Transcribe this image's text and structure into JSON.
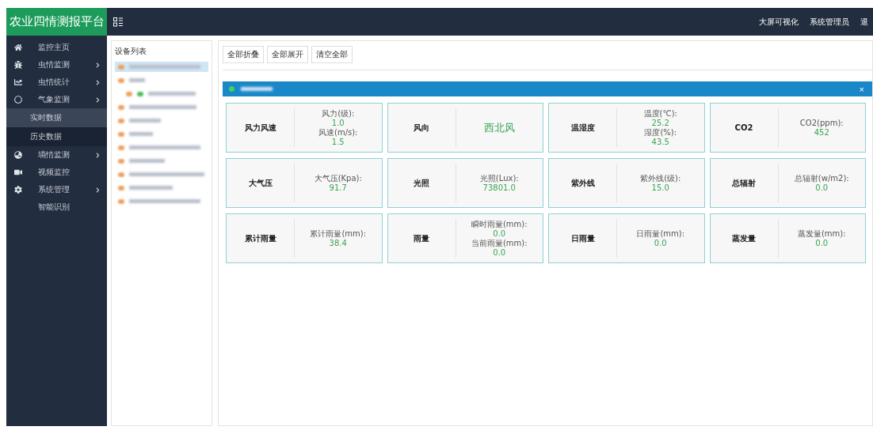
{
  "header": {
    "logo": "农业四情测报平台",
    "links": [
      "大屏可视化",
      "系统管理员",
      "退"
    ]
  },
  "sidebar": {
    "items": [
      {
        "label": "监控主页",
        "has_submenu": false
      },
      {
        "label": "虫情监测",
        "has_submenu": true
      },
      {
        "label": "虫情统计",
        "has_submenu": true
      },
      {
        "label": "气象监测",
        "has_submenu": true,
        "expanded": true,
        "children": [
          {
            "label": "实时数据",
            "selected": true
          },
          {
            "label": "历史数据",
            "selected": false
          }
        ]
      },
      {
        "label": "墒情监测",
        "has_submenu": true
      },
      {
        "label": "视频监控",
        "has_submenu": false
      },
      {
        "label": "系统管理",
        "has_submenu": true
      },
      {
        "label": "智能识别",
        "has_submenu": false
      }
    ]
  },
  "device_list": {
    "title": "设备列表",
    "rows": [
      {
        "selected": true
      },
      {
        "selected": false,
        "children": [
          {
            "selected": false
          }
        ]
      },
      {
        "selected": false
      },
      {
        "selected": false
      },
      {
        "selected": false
      },
      {
        "selected": false
      },
      {
        "selected": false
      },
      {
        "selected": false
      },
      {
        "selected": false
      },
      {
        "selected": false
      }
    ]
  },
  "toolbar": {
    "buttons": [
      "全部折叠",
      "全部展开",
      "清空全部"
    ]
  },
  "station": {
    "online": true,
    "close": "×"
  },
  "cards": [
    {
      "title": "风力风速",
      "kind": "readings",
      "readings": [
        {
          "label": "风力(级):",
          "value": "1.0"
        },
        {
          "label": "风速(m/s):",
          "value": "1.5"
        }
      ]
    },
    {
      "title": "风向",
      "kind": "text",
      "value": "西北风"
    },
    {
      "title": "温湿度",
      "kind": "readings",
      "readings": [
        {
          "label": "温度(℃):",
          "value": "25.2"
        },
        {
          "label": "湿度(%):",
          "value": "43.5"
        }
      ]
    },
    {
      "title": "CO2",
      "kind": "readings",
      "readings": [
        {
          "label": "CO2(ppm):",
          "value": "452"
        }
      ]
    },
    {
      "title": "大气压",
      "kind": "readings",
      "readings": [
        {
          "label": "大气压(Kpa):",
          "value": "91.7"
        }
      ]
    },
    {
      "title": "光照",
      "kind": "readings",
      "readings": [
        {
          "label": "光照(Lux):",
          "value": "73801.0"
        }
      ]
    },
    {
      "title": "紫外线",
      "kind": "readings",
      "readings": [
        {
          "label": "紫外线(级):",
          "value": "15.0"
        }
      ]
    },
    {
      "title": "总辐射",
      "kind": "readings",
      "readings": [
        {
          "label": "总辐射(w/m2):",
          "value": "0.0"
        }
      ]
    },
    {
      "title": "累计雨量",
      "kind": "readings",
      "readings": [
        {
          "label": "累计雨量(mm):",
          "value": "38.4"
        }
      ]
    },
    {
      "title": "雨量",
      "kind": "readings",
      "readings": [
        {
          "label": "瞬时雨量(mm):",
          "value": "0.0"
        },
        {
          "label": "当前雨量(mm):",
          "value": "0.0"
        }
      ]
    },
    {
      "title": "日雨量",
      "kind": "readings",
      "readings": [
        {
          "label": "日雨量(mm):",
          "value": "0.0"
        }
      ]
    },
    {
      "title": "蒸发量",
      "kind": "readings",
      "readings": [
        {
          "label": "蒸发量(mm):",
          "value": "0.0"
        }
      ]
    }
  ]
}
